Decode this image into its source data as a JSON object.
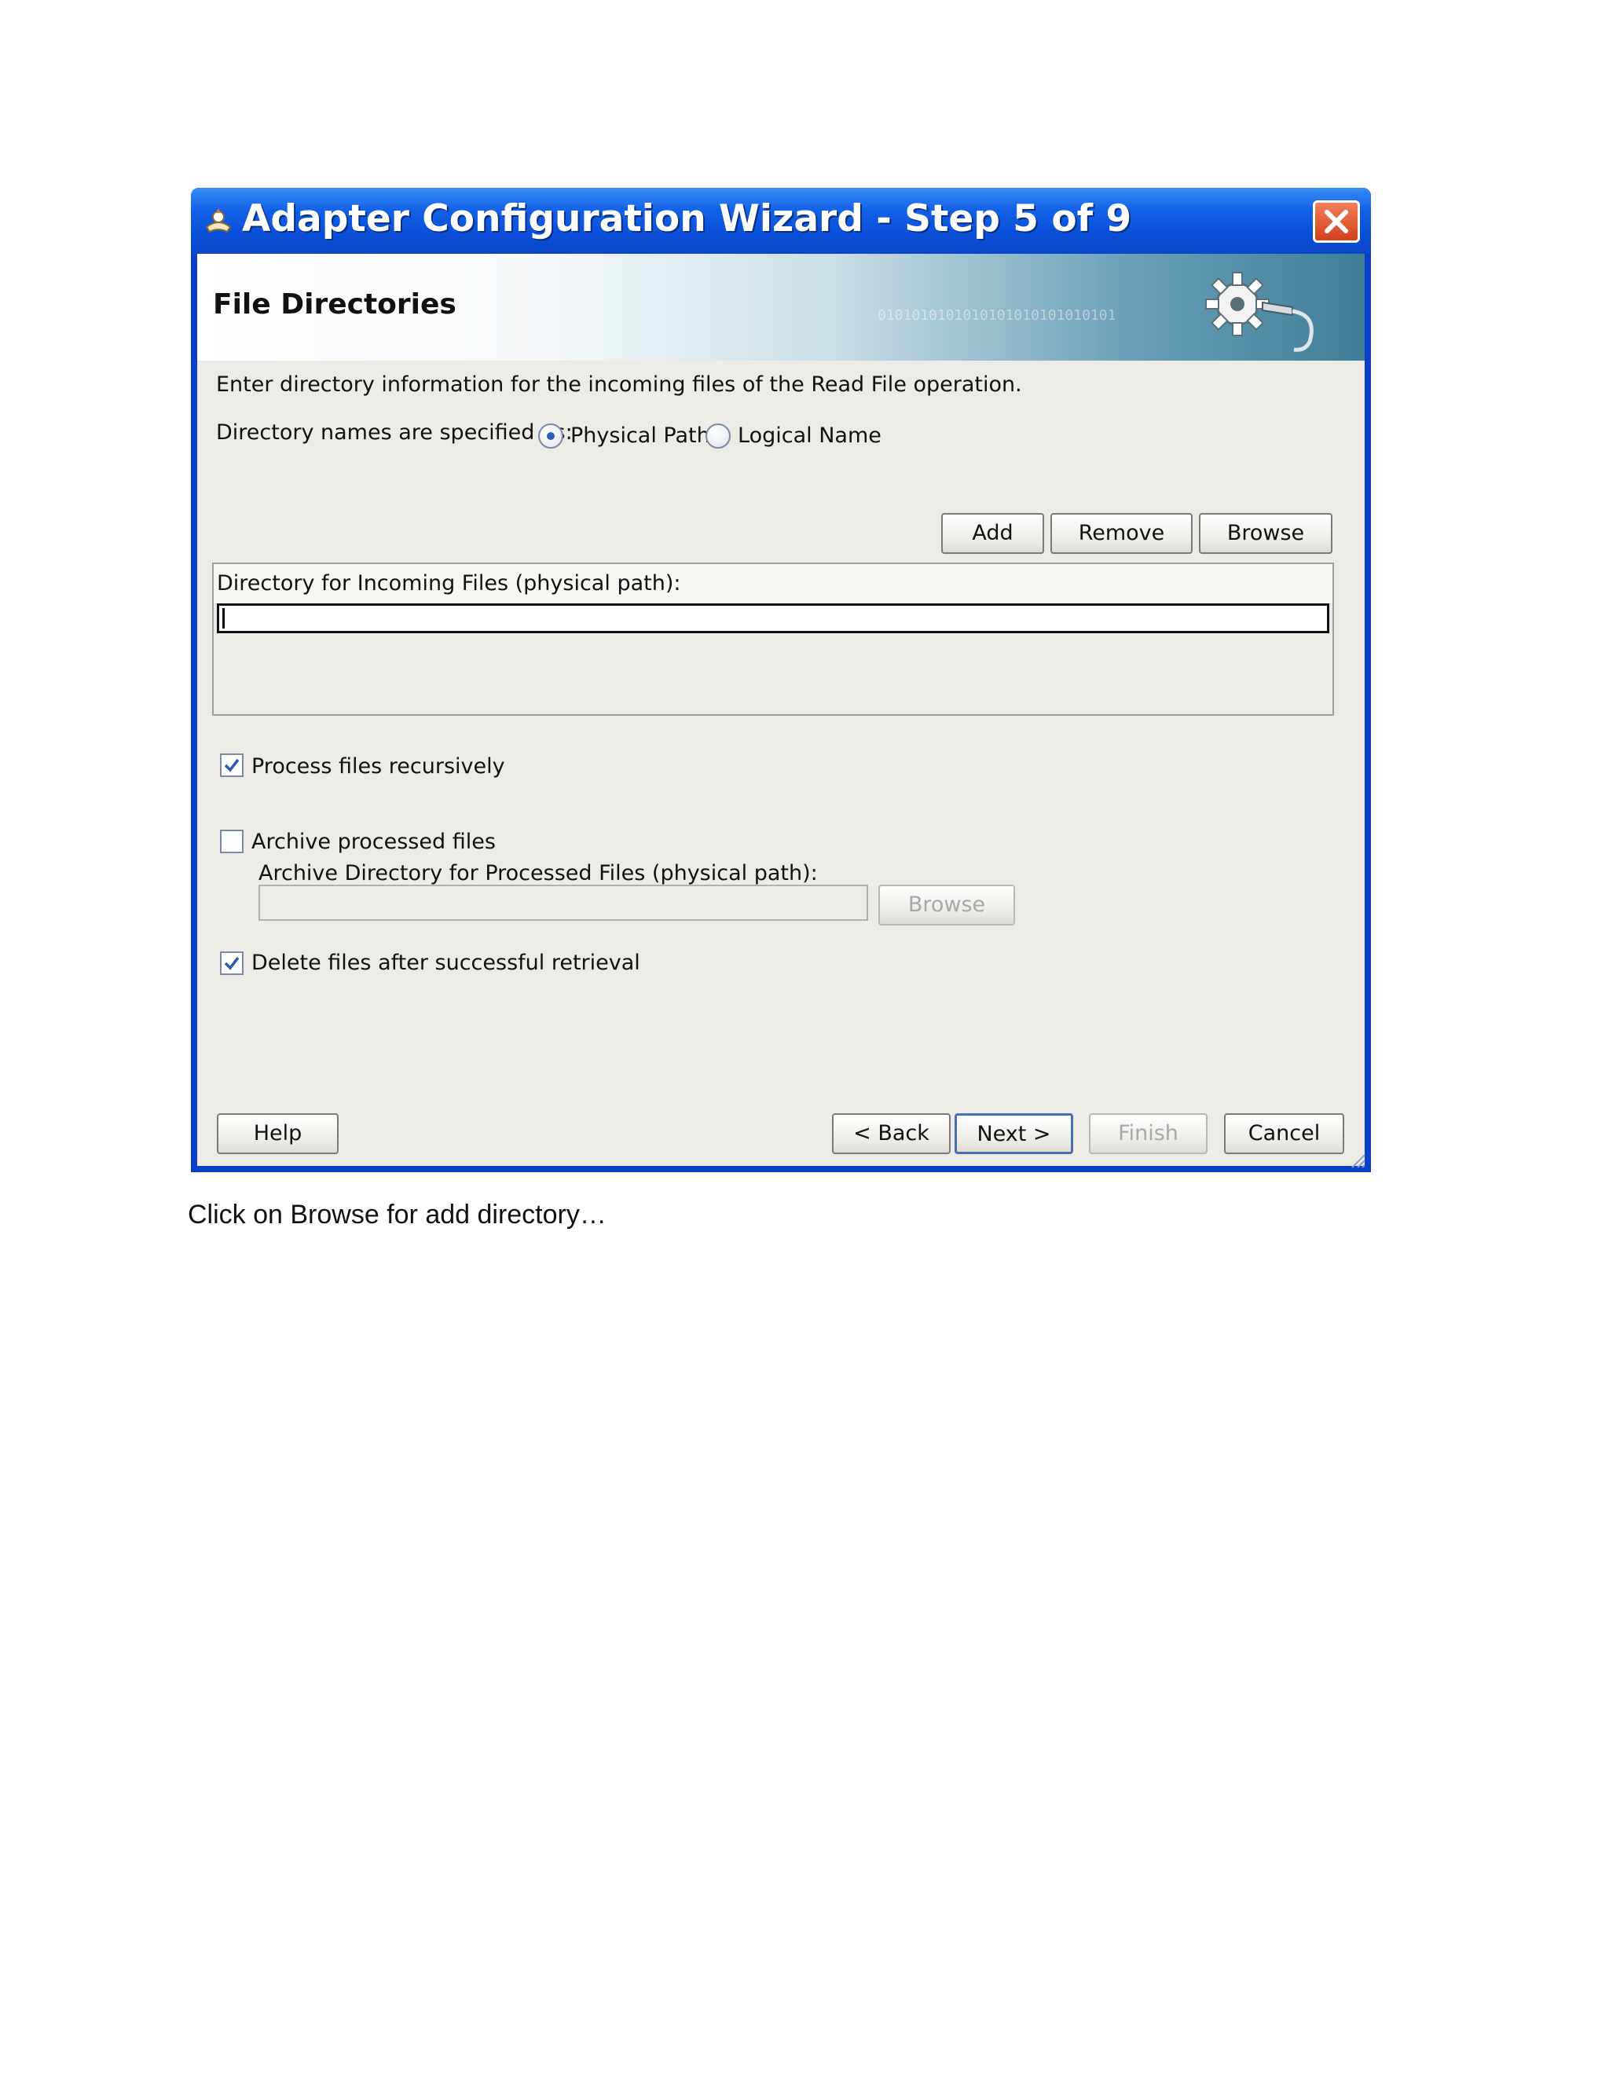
{
  "window": {
    "title": "Adapter Configuration Wizard - Step 5 of 9",
    "icon": "wizard-app-icon",
    "close_icon": "close-icon"
  },
  "header": {
    "title": "File Directories",
    "binary_text": "0101010101010101010101010101"
  },
  "intro": "Enter directory information for the incoming files of the Read File operation.",
  "directory_mode": {
    "label": "Directory names are specified as:",
    "options": [
      {
        "label": "Physical Path",
        "selected": true
      },
      {
        "label": "Logical Name",
        "selected": false
      }
    ]
  },
  "list_buttons": {
    "add": "Add",
    "remove": "Remove",
    "browse": "Browse"
  },
  "incoming": {
    "column_header": "Directory for Incoming Files (physical path):",
    "value": ""
  },
  "options": {
    "process_recursively": {
      "label": "Process files recursively",
      "checked": true
    },
    "archive": {
      "label": "Archive processed files",
      "checked": false
    },
    "archive_dir_label": "Archive Directory for Processed Files (physical path):",
    "archive_dir_value": "",
    "archive_browse": "Browse",
    "delete_after": {
      "label": "Delete files after successful retrieval",
      "checked": true
    }
  },
  "footer": {
    "help": "Help",
    "back": "< Back",
    "next": "Next >",
    "finish": "Finish",
    "cancel": "Cancel"
  },
  "caption": "Click on Browse for add directory…",
  "colors": {
    "titlebar": "#0b4fd8",
    "dialog_bg": "#ecebe6",
    "close_button": "#d2401c"
  }
}
